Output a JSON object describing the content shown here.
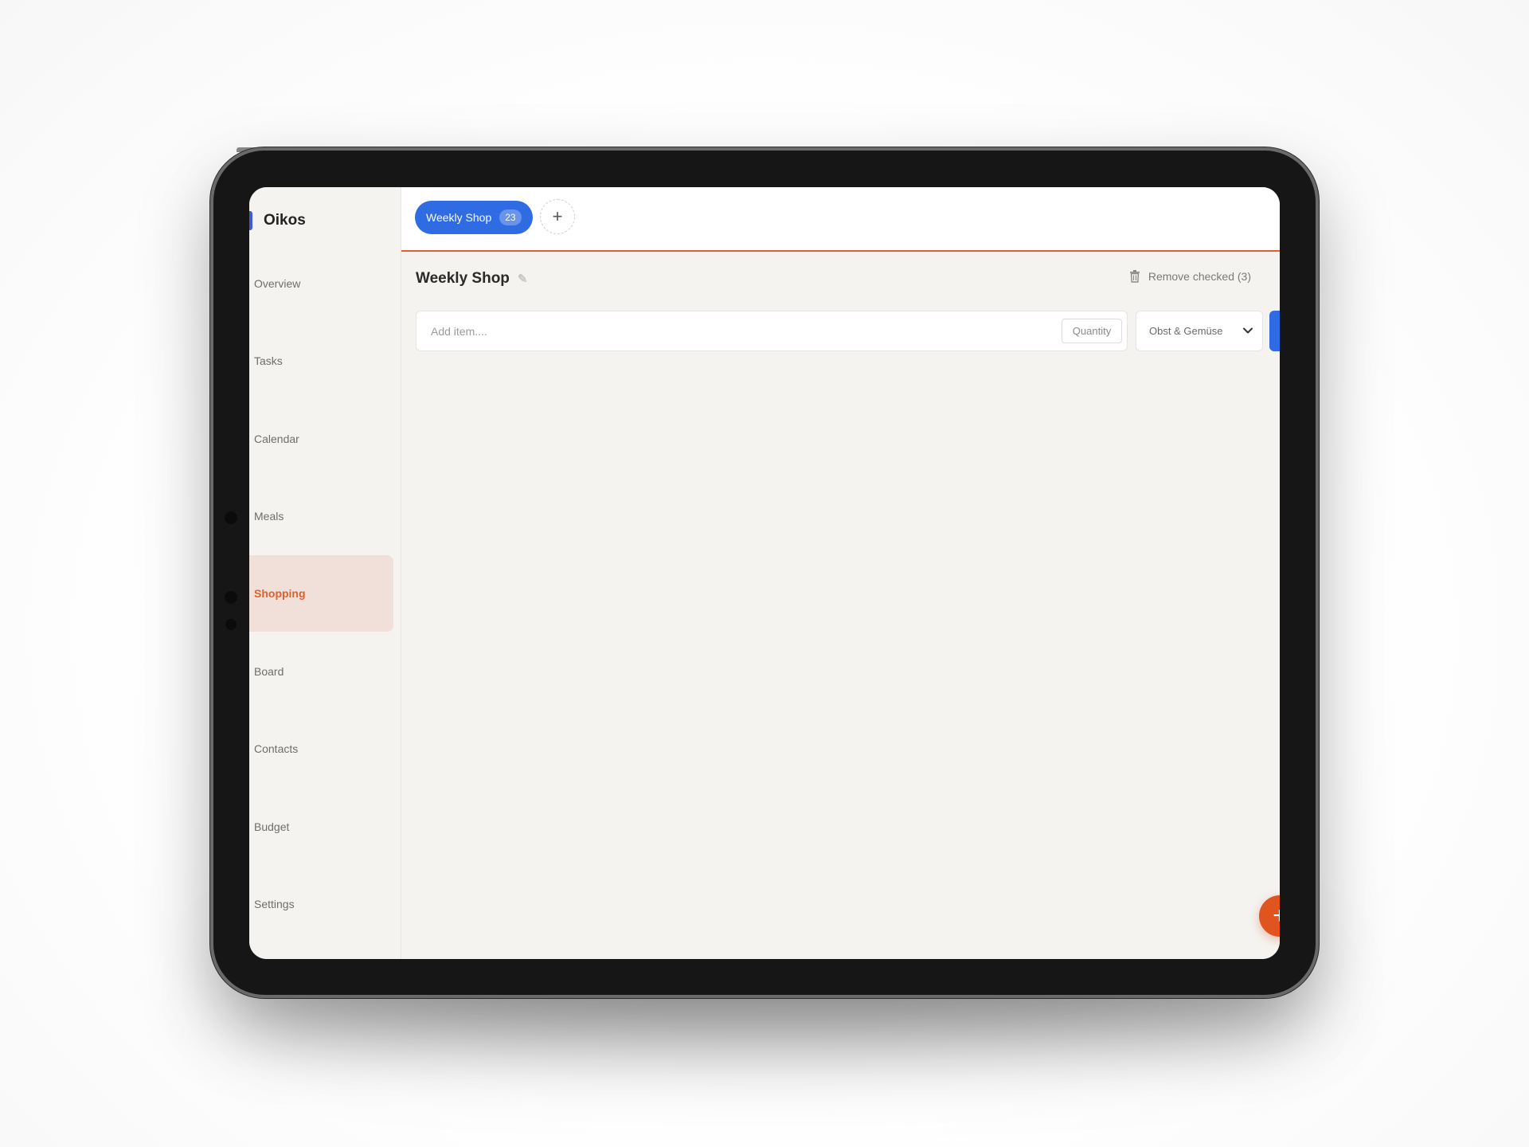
{
  "app": {
    "name": "Oikos"
  },
  "sidebar": {
    "items": [
      {
        "label": "Overview",
        "active": false
      },
      {
        "label": "Tasks",
        "active": false
      },
      {
        "label": "Calendar",
        "active": false
      },
      {
        "label": "Meals",
        "active": false
      },
      {
        "label": "Shopping",
        "active": true
      },
      {
        "label": "Board",
        "active": false
      },
      {
        "label": "Contacts",
        "active": false
      },
      {
        "label": "Budget",
        "active": false
      },
      {
        "label": "Settings",
        "active": false
      }
    ]
  },
  "tabs": {
    "active": {
      "label": "Weekly Shop",
      "count": "23"
    },
    "add_icon": "plus-icon"
  },
  "list": {
    "title": "Weekly Shop",
    "edit_icon": "pencil-icon",
    "remove_checked_label": "Remove checked (3)",
    "remove_icon": "trash-icon"
  },
  "add_form": {
    "item_placeholder": "Add item....",
    "quantity_placeholder": "Quantity",
    "category_selected": "Obst & Gemüse"
  },
  "colors": {
    "accent": "#e0602b",
    "primary": "#2f6be3",
    "active_nav_bg": "#f1e0d9",
    "background": "#f4f3f0"
  }
}
